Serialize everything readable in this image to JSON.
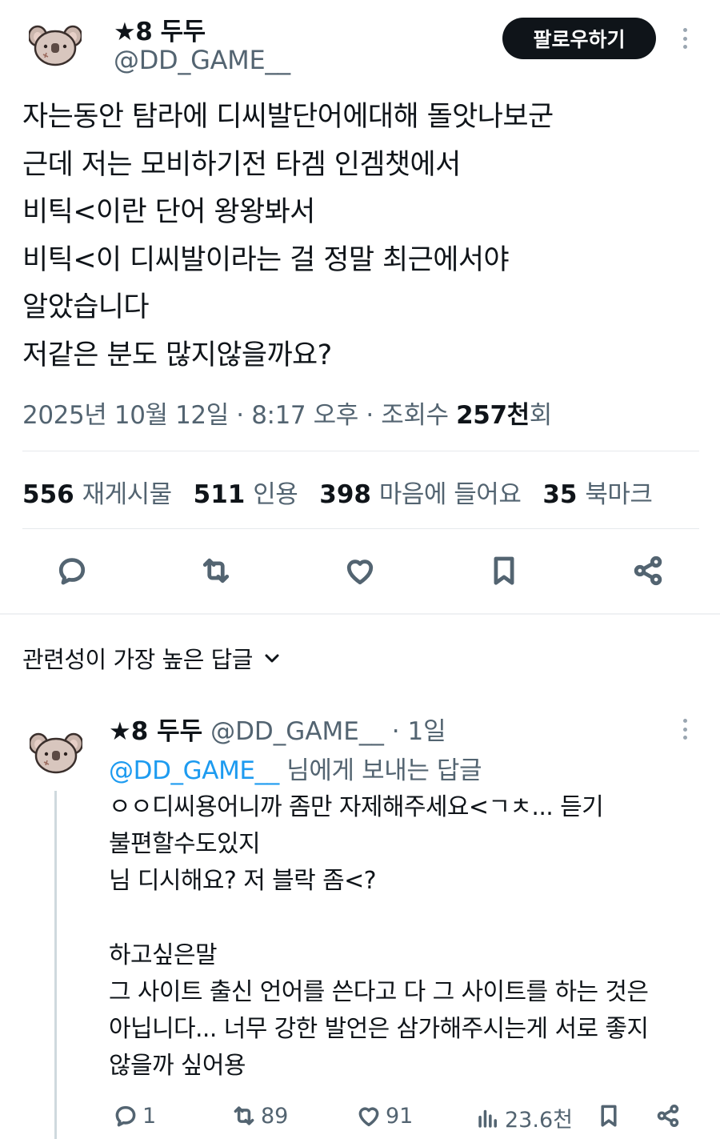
{
  "tweet": {
    "author": {
      "display_name": "★8 두두",
      "handle": "@DD_GAME__"
    },
    "follow_label": "팔로우하기",
    "text_lines": [
      "자는동안 탐라에 디씨발단어에대해 돌앗나보군",
      "근데 저는 모비하기전 타겜 인겜챗에서",
      "비틱<이란 단어 왕왕봐서",
      "비틱<이 디씨발이라는 걸 정말 최근에서야",
      "알았습니다",
      "저같은 분도 많지않을까요?"
    ],
    "meta": {
      "datetime": "2025년 10월 12일 · 8:17 오후 · 조회수 ",
      "views": "257천",
      "views_suffix": "회"
    },
    "stats": {
      "retweets": {
        "count": "556",
        "label": "재게시물"
      },
      "quotes": {
        "count": "511",
        "label": "인용"
      },
      "likes": {
        "count": "398",
        "label": "마음에 들어요"
      },
      "bookmarks": {
        "count": "35",
        "label": "북마크"
      }
    }
  },
  "replies_section": {
    "sort_label": "관련성이 가장 높은 답글"
  },
  "reply": {
    "display_name": "★8 두두",
    "handle": "@DD_GAME__",
    "time": "· 1일",
    "replying_to_handle": "@DD_GAME__",
    "replying_to_suffix": " 님에게 보내는 답글",
    "text_lines": [
      "ㅇㅇ디씨용어니까 좀만 자제해주세요<ㄱㅊ... 듣기",
      "불편할수도있지",
      "님 디시해요? 저 블락 좀<?",
      "",
      "하고싶은말",
      "그 사이트 출신 언어를 쓴다고 다 그 사이트를 하는 것은",
      "아닙니다... 너무 강한 발언은 삼가해주시는게 서로 좋지",
      "않을까 싶어용"
    ],
    "actions": {
      "replies": "1",
      "retweets": "89",
      "likes": "91",
      "views": "23.6천"
    }
  },
  "colors": {
    "text": "#0f1419",
    "secondary": "#536471",
    "link": "#1d9bf0",
    "divider": "#e6e9ec"
  },
  "icons": [
    "avatar-koala",
    "more-icon",
    "reply-icon",
    "retweet-icon",
    "heart-icon",
    "bookmark-icon",
    "share-icon",
    "chevron-down-icon",
    "views-icon"
  ]
}
